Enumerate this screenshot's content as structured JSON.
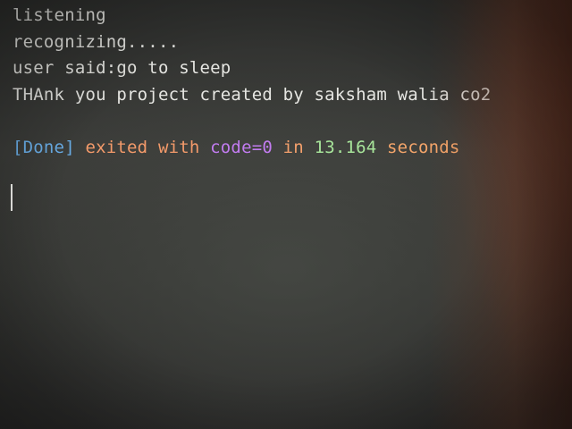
{
  "terminal": {
    "lines": [
      "listening",
      "recognizing.....",
      "user said:go to sleep",
      "THAnk you project created by saksham walia co2"
    ],
    "status": {
      "done": "[Done]",
      "exited": "exited with",
      "code": "code=0",
      "in": "in",
      "duration": "13.164",
      "unit": "seconds"
    }
  },
  "colors": {
    "done": "#6aaee8",
    "exited": "#f39a6a",
    "code": "#c27cf0",
    "duration": "#a7e49a"
  }
}
